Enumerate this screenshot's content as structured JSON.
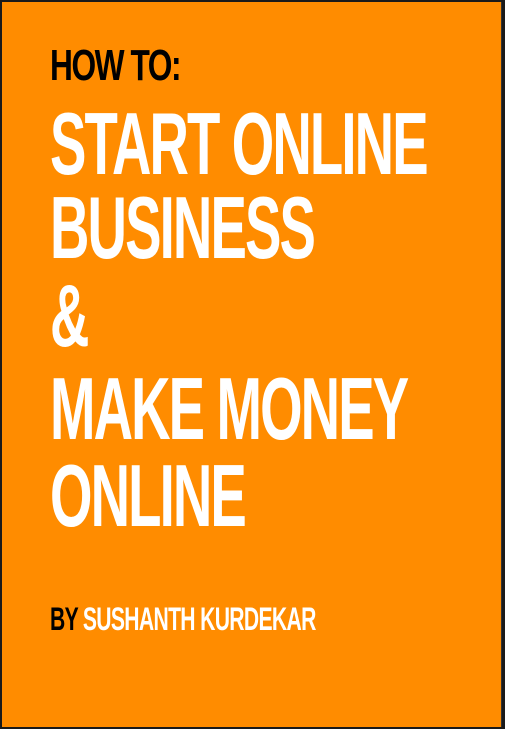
{
  "cover": {
    "background_color": "#ff8c00",
    "kicker": "HOW TO:",
    "title_lines": [
      "START ONLINE",
      "BUSINESS",
      "&",
      "MAKE MONEY",
      "ONLINE"
    ],
    "byline_prefix": "BY",
    "author": "SUSHANTH KURDEKAR"
  }
}
